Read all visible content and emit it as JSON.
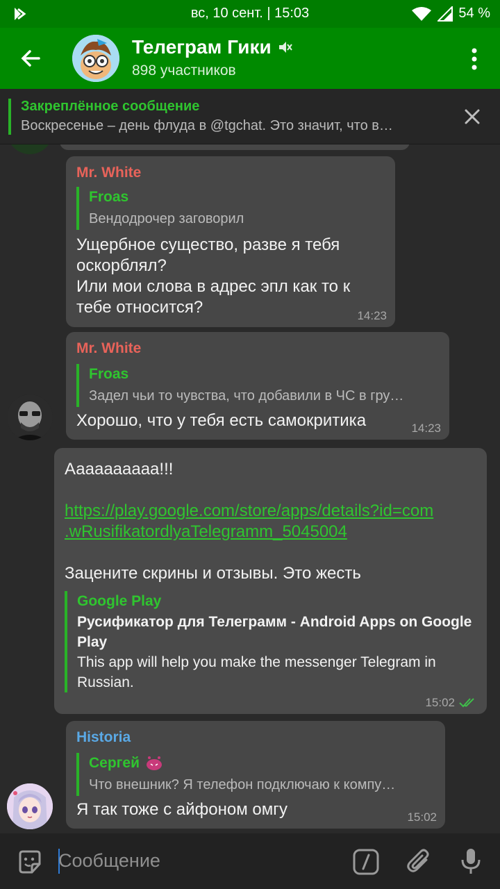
{
  "status_bar": {
    "datetime": "вс, 10 сент. | 15:03",
    "battery": "54 %"
  },
  "header": {
    "title": "Телеграм Гики",
    "subtitle": "898 участников"
  },
  "pinned": {
    "title": "Закреплённое сообщение",
    "text": "Воскресенье – день флуда в @tgchat.  Это значит, что в…"
  },
  "messages": [
    {
      "sender": "Mr. White",
      "reply_name": "Froas",
      "reply_text": "Вендодрочер заговорил",
      "text_lines": [
        "Ущербное существо, разве я тебя",
        "оскорблял?",
        "Или мои слова в адрес эпл как то к",
        "тебе относится?"
      ],
      "time": "14:23"
    },
    {
      "sender": "Mr. White",
      "reply_name": "Froas",
      "reply_text": "Задел чьи то чувства, что добавили в ЧС в гру…",
      "text": "Хорошо, что у тебя есть самокритика",
      "time": "14:23"
    },
    {
      "text_first": "Аааааааааа!!!",
      "link_lines": [
        "https://play.google.com/store/apps/details?id=com",
        ".wRusifikatordlyaTelegramm_5045004"
      ],
      "text_second": "Зацените скрины и отзывы. Это жесть",
      "preview_site": "Google Play",
      "preview_title_lines": [
        "Русификатор для Телеграмм - Android Apps on Google",
        "Play"
      ],
      "preview_desc_lines": [
        "This app will help you make the messenger Telegram in",
        "Russian."
      ],
      "time": "15:02"
    },
    {
      "sender": "Historia",
      "reply_name": "Сергей",
      "reply_text": "Что внешник? Я телефон подключаю к компу…",
      "text": "Я так тоже с айфоном омгу",
      "time": "15:02"
    }
  ],
  "input": {
    "placeholder": "Сообщение"
  },
  "colors": {
    "header_green": "#008a00",
    "accent_green": "#2fc52f",
    "sender_red": "#e8635a",
    "sender_blue": "#5aa9e6",
    "bubble": "#474747"
  }
}
